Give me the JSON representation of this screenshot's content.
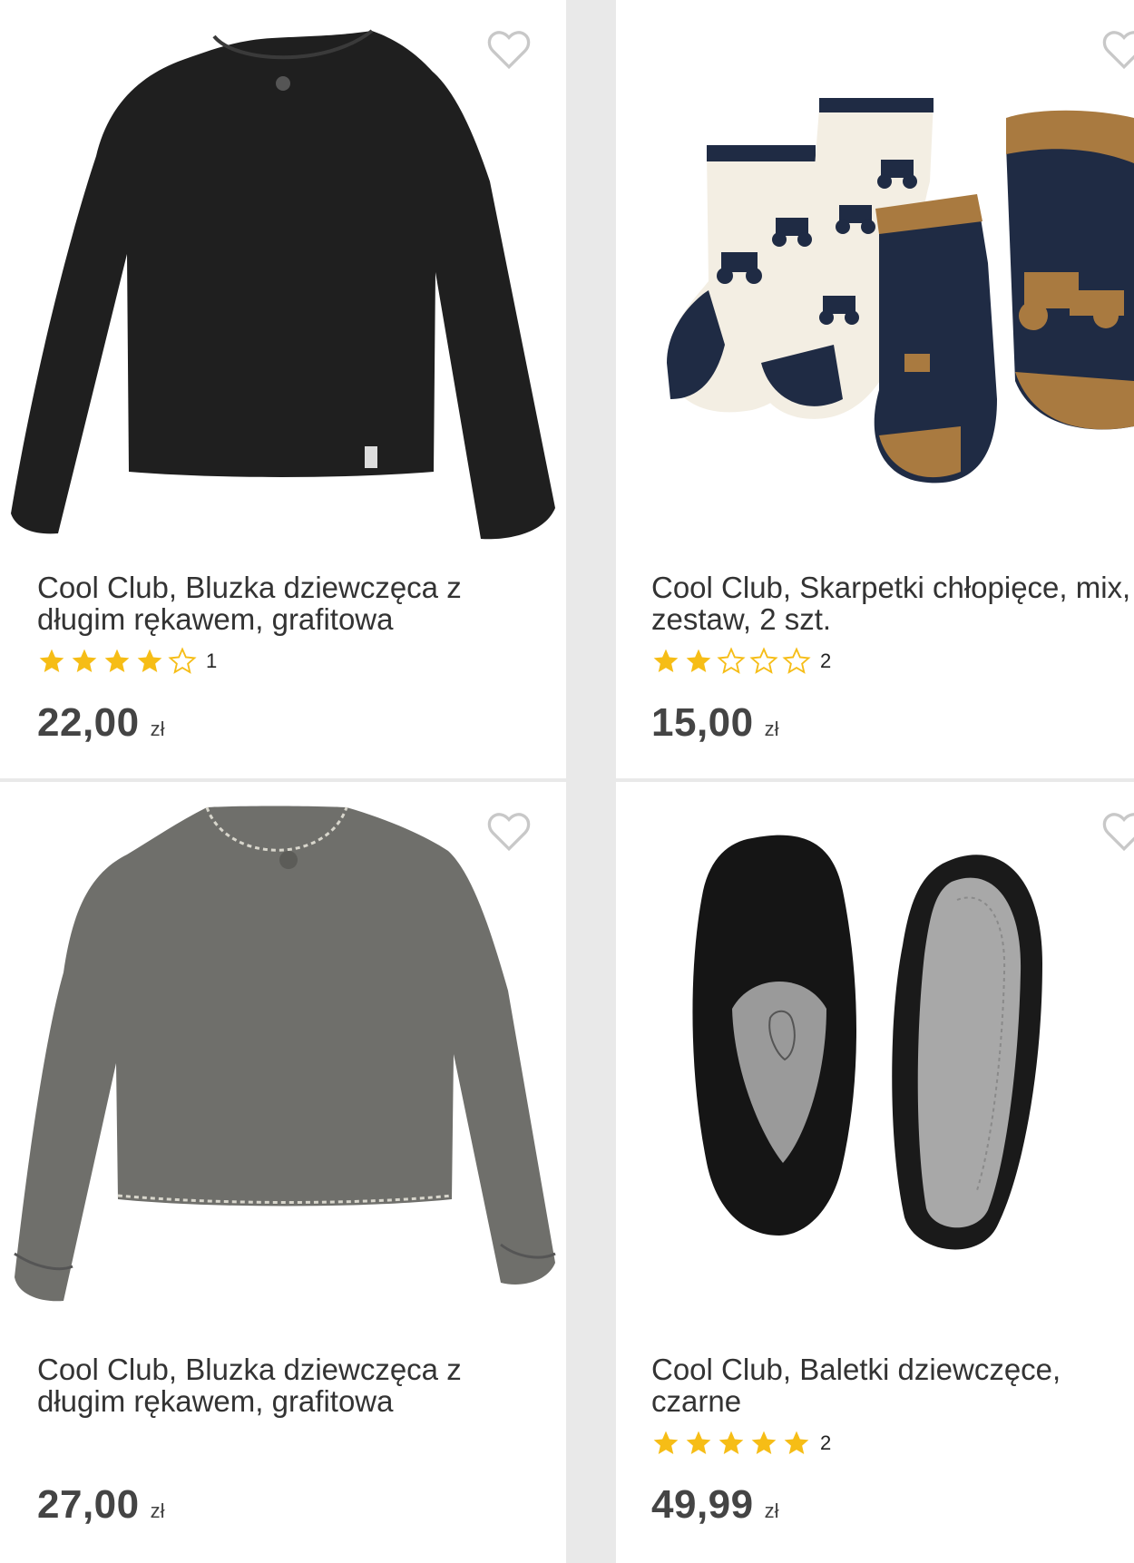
{
  "products": [
    {
      "title_line1": "Cool Club, Bluzka dziewczęca z",
      "title_line2": "długim rękawem, grafitowa",
      "rating": 4,
      "rating_count": "1",
      "price": "22,00",
      "currency": "zł",
      "image_icon": "black-long-sleeve-shirt-image"
    },
    {
      "title_line1": "Cool Club, Skarpetki chłopięce, mix,",
      "title_line2": "zestaw, 2 szt.",
      "rating": 2,
      "rating_count": "2",
      "price": "15,00",
      "currency": "zł",
      "image_icon": "tractor-socks-image"
    },
    {
      "title_line1": "Cool Club, Bluzka dziewczęca z",
      "title_line2": "długim rękawem, grafitowa",
      "rating": 0,
      "rating_count": "",
      "price": "27,00",
      "currency": "zł",
      "image_icon": "grey-sweatshirt-image"
    },
    {
      "title_line1": "Cool Club, Baletki dziewczęce,",
      "title_line2": "czarne",
      "rating": 5,
      "rating_count": "2",
      "price": "49,99",
      "currency": "zł",
      "image_icon": "black-ballet-shoes-image"
    }
  ],
  "colors": {
    "star_filled": "#f6bd16",
    "star_outline": "#f6bd16",
    "heart": "#c8c8c8",
    "text": "#333333",
    "background": "#e9e9e9"
  }
}
